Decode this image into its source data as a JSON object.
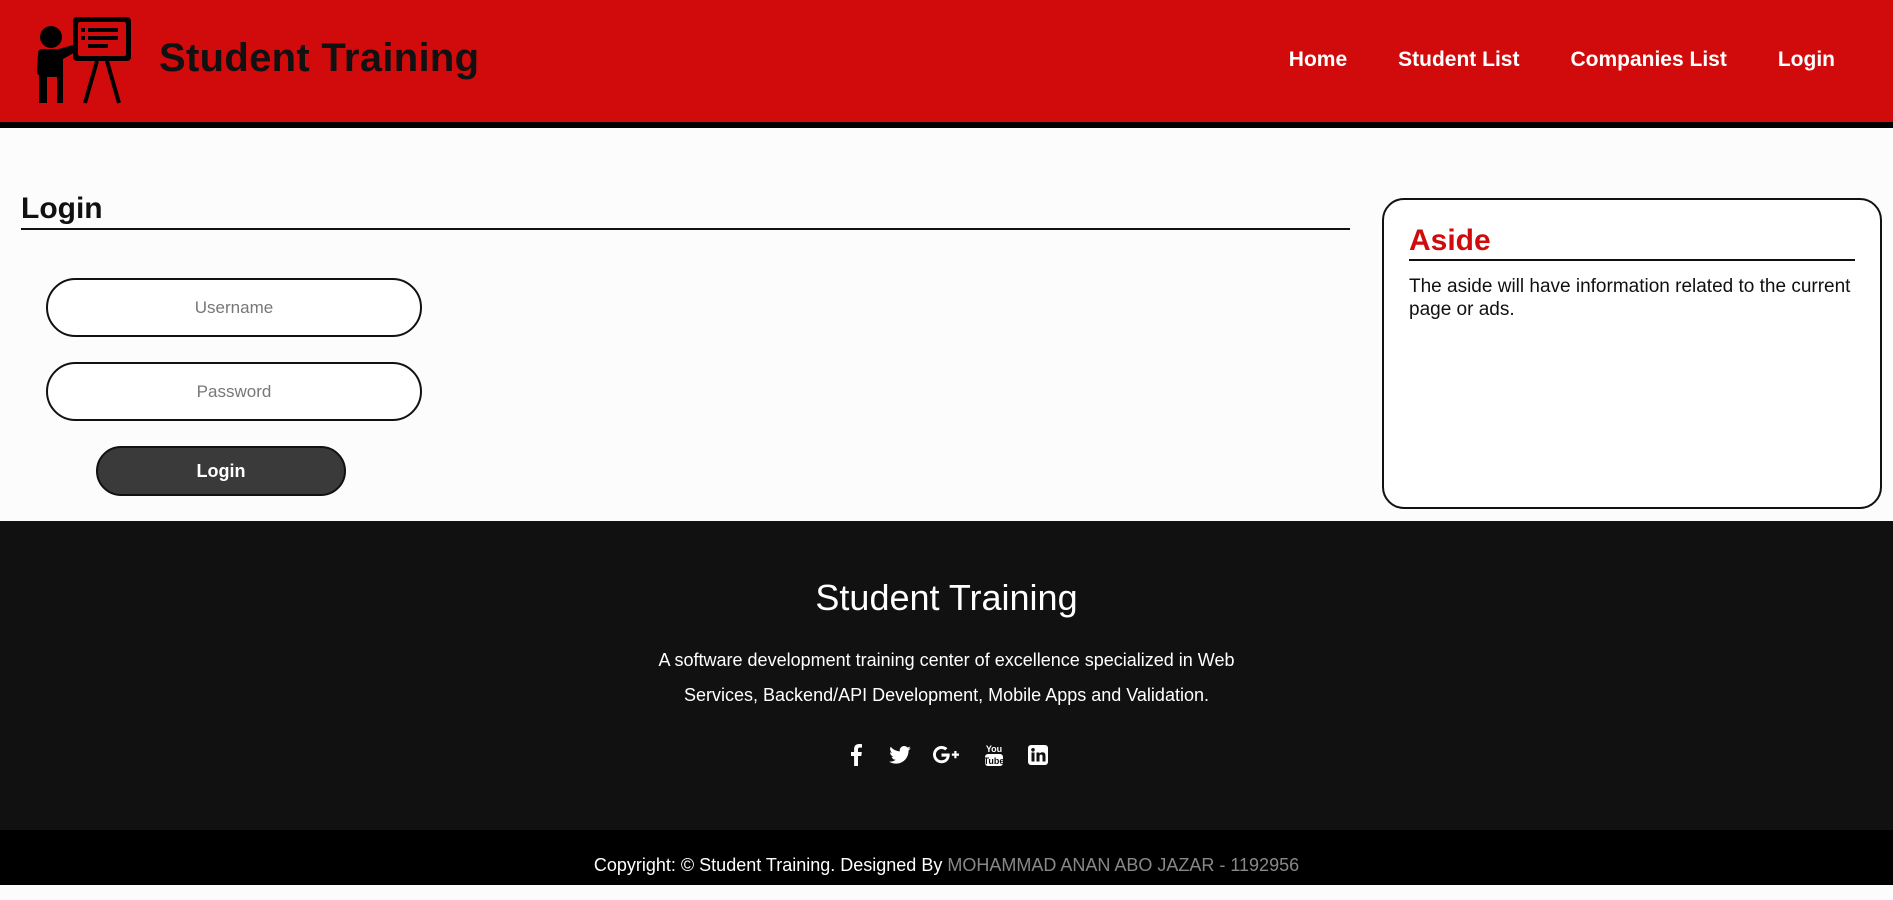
{
  "header": {
    "site_title": "Student Training",
    "logo_icon": "teacher-board-icon",
    "nav": [
      {
        "label": "Home"
      },
      {
        "label": "Student List"
      },
      {
        "label": "Companies List"
      },
      {
        "label": "Login"
      }
    ]
  },
  "main": {
    "heading": "Login",
    "form": {
      "username_placeholder": "Username",
      "username_value": "",
      "password_placeholder": "Password",
      "password_value": "",
      "submit_label": "Login"
    },
    "aside": {
      "title": "Aside",
      "text": "The aside will have information related to the current page or ads."
    }
  },
  "footer": {
    "title": "Student Training",
    "description": "A software development training center of excellence specialized in Web Services, Backend/API Development, Mobile Apps and Validation.",
    "social_icons": [
      "facebook-icon",
      "twitter-icon",
      "google-plus-icon",
      "youtube-icon",
      "linkedin-icon"
    ],
    "copyright_prefix": "Copyright: © Student Training. Designed By ",
    "designer": "MOHAMMAD ANAN ABO JAZAR - 1192956"
  },
  "colors": {
    "brand_red": "#d10b0b",
    "footer_bg": "#111111",
    "copyright_bg": "#000000"
  }
}
